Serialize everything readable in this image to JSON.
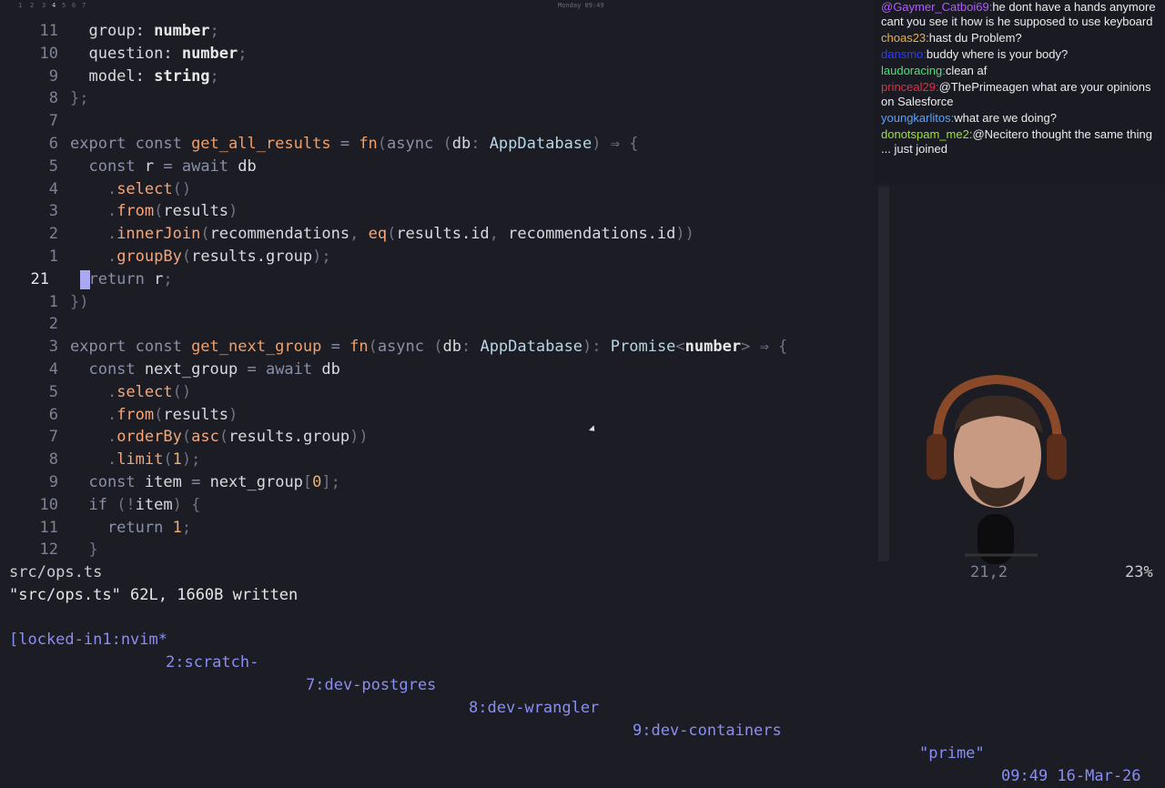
{
  "topbar": {
    "workspaces": [
      "1",
      "2",
      "3",
      "4",
      "5",
      "6",
      "7"
    ],
    "clock": "Monday 09:49"
  },
  "editor": {
    "lines": [
      {
        "num": "11",
        "code": [
          [
            "id",
            "  group: "
          ],
          [
            "tyb",
            "number"
          ],
          [
            "pu",
            ";"
          ]
        ]
      },
      {
        "num": "10",
        "code": [
          [
            "id",
            "  question: "
          ],
          [
            "tyb",
            "number"
          ],
          [
            "pu",
            ";"
          ]
        ]
      },
      {
        "num": "9",
        "code": [
          [
            "id",
            "  model: "
          ],
          [
            "tyb",
            "string"
          ],
          [
            "pu",
            ";"
          ]
        ]
      },
      {
        "num": "8",
        "code": [
          [
            "pu",
            "};"
          ]
        ]
      },
      {
        "num": "7",
        "code": []
      },
      {
        "num": "6",
        "code": [
          [
            "kw",
            "export const "
          ],
          [
            "fn",
            "get_all_results"
          ],
          [
            "kw",
            " = "
          ],
          [
            "fn",
            "fn"
          ],
          [
            "pu",
            "("
          ],
          [
            "kw",
            "async "
          ],
          [
            "pu",
            "("
          ],
          [
            "id",
            "db"
          ],
          [
            "pu",
            ": "
          ],
          [
            "ty",
            "AppDatabase"
          ],
          [
            "pu",
            ") ⇒ {"
          ]
        ]
      },
      {
        "num": "5",
        "code": [
          [
            "kw",
            "  const "
          ],
          [
            "id",
            "r "
          ],
          [
            "kw",
            "= await "
          ],
          [
            "id",
            "db"
          ]
        ]
      },
      {
        "num": "4",
        "code": [
          [
            "pu",
            "    ."
          ],
          [
            "meth",
            "select"
          ],
          [
            "pu",
            "()"
          ]
        ]
      },
      {
        "num": "3",
        "code": [
          [
            "pu",
            "    ."
          ],
          [
            "meth",
            "from"
          ],
          [
            "pu",
            "("
          ],
          [
            "id",
            "results"
          ],
          [
            "pu",
            ")"
          ]
        ]
      },
      {
        "num": "2",
        "code": [
          [
            "pu",
            "    ."
          ],
          [
            "meth",
            "innerJoin"
          ],
          [
            "pu",
            "("
          ],
          [
            "id",
            "recommendations"
          ],
          [
            "pu",
            ", "
          ],
          [
            "meth",
            "eq"
          ],
          [
            "pu",
            "("
          ],
          [
            "id",
            "results.id"
          ],
          [
            "pu",
            ", "
          ],
          [
            "id",
            "recommendations.id"
          ],
          [
            "pu",
            "))"
          ]
        ]
      },
      {
        "num": "1",
        "code": [
          [
            "pu",
            "    ."
          ],
          [
            "meth",
            "groupBy"
          ],
          [
            "pu",
            "("
          ],
          [
            "id",
            "results.group"
          ],
          [
            "pu",
            ");"
          ]
        ]
      },
      {
        "num": "21",
        "current": true,
        "code": [
          [
            "kw",
            "  return "
          ],
          [
            "id",
            "r"
          ],
          [
            "pu",
            ";"
          ]
        ]
      },
      {
        "num": "1",
        "code": [
          [
            "pu",
            "})"
          ]
        ]
      },
      {
        "num": "2",
        "code": []
      },
      {
        "num": "3",
        "code": [
          [
            "kw",
            "export const "
          ],
          [
            "fn",
            "get_next_group"
          ],
          [
            "kw",
            " = "
          ],
          [
            "fn",
            "fn"
          ],
          [
            "pu",
            "("
          ],
          [
            "kw",
            "async "
          ],
          [
            "pu",
            "("
          ],
          [
            "id",
            "db"
          ],
          [
            "pu",
            ": "
          ],
          [
            "ty",
            "AppDatabase"
          ],
          [
            "pu",
            "): "
          ],
          [
            "ty",
            "Promise"
          ],
          [
            "pu",
            "<"
          ],
          [
            "tyb",
            "number"
          ],
          [
            "pu",
            "> ⇒ {"
          ]
        ]
      },
      {
        "num": "4",
        "code": [
          [
            "kw",
            "  const "
          ],
          [
            "id",
            "next_group "
          ],
          [
            "kw",
            "= await "
          ],
          [
            "id",
            "db"
          ]
        ]
      },
      {
        "num": "5",
        "code": [
          [
            "pu",
            "    ."
          ],
          [
            "meth",
            "select"
          ],
          [
            "pu",
            "()"
          ]
        ]
      },
      {
        "num": "6",
        "code": [
          [
            "pu",
            "    ."
          ],
          [
            "meth",
            "from"
          ],
          [
            "pu",
            "("
          ],
          [
            "id",
            "results"
          ],
          [
            "pu",
            ")"
          ]
        ]
      },
      {
        "num": "7",
        "code": [
          [
            "pu",
            "    ."
          ],
          [
            "meth",
            "orderBy"
          ],
          [
            "pu",
            "("
          ],
          [
            "meth",
            "asc"
          ],
          [
            "pu",
            "("
          ],
          [
            "id",
            "results.group"
          ],
          [
            "pu",
            "))"
          ]
        ]
      },
      {
        "num": "8",
        "code": [
          [
            "pu",
            "    ."
          ],
          [
            "meth",
            "limit"
          ],
          [
            "pu",
            "("
          ],
          [
            "num",
            "1"
          ],
          [
            "pu",
            ");"
          ]
        ]
      },
      {
        "num": "9",
        "code": [
          [
            "kw",
            "  const "
          ],
          [
            "id",
            "item "
          ],
          [
            "kw",
            "= "
          ],
          [
            "id",
            "next_group"
          ],
          [
            "pu",
            "["
          ],
          [
            "num",
            "0"
          ],
          [
            "pu",
            "];"
          ]
        ]
      },
      {
        "num": "10",
        "code": [
          [
            "kw",
            "  if "
          ],
          [
            "pu",
            "(!"
          ],
          [
            "id",
            "item"
          ],
          [
            "pu",
            ") {"
          ]
        ]
      },
      {
        "num": "11",
        "code": [
          [
            "kw",
            "    return "
          ],
          [
            "num",
            "1"
          ],
          [
            "pu",
            ";"
          ]
        ]
      },
      {
        "num": "12",
        "code": [
          [
            "pu",
            "  }"
          ]
        ]
      }
    ]
  },
  "chat": [
    {
      "user": "@Gaymer_Catboi69:",
      "color": "#b05cff",
      "text": "he dont have a hands anymore cant you see it how is he supposed to use keyboard"
    },
    {
      "user": "choas23:",
      "color": "#e8b04a",
      "text": "hast du Problem?"
    },
    {
      "user": "dansmo:",
      "color": "#2b3bff",
      "text": "buddy where is your body?"
    },
    {
      "user": "laudoracing:",
      "color": "#4ee07a",
      "text": "clean af"
    },
    {
      "user": "princeal29:",
      "color": "#d8344a",
      "text": "@ThePrimeagen what are your opinions on Salesforce"
    },
    {
      "user": "youngkarlitos:",
      "color": "#5aa0ff",
      "text": "what are we doing?"
    },
    {
      "user": "donotspam_me2:",
      "color": "#9ee040",
      "text": "@Necitero thought the same thing ... just joined"
    }
  ],
  "status": {
    "filename": "src/ops.ts",
    "position": "21,2",
    "percent": "23%"
  },
  "cmdline": "\"src/ops.ts\" 62L, 1660B written",
  "tmux": {
    "windows": [
      "[locked-in1:nvim*",
      "2:scratch-",
      "7:dev-postgres",
      "8:dev-wrangler",
      "9:dev-containers"
    ],
    "host": "\"prime\"",
    "time": "09:49 16-Mar-26"
  }
}
